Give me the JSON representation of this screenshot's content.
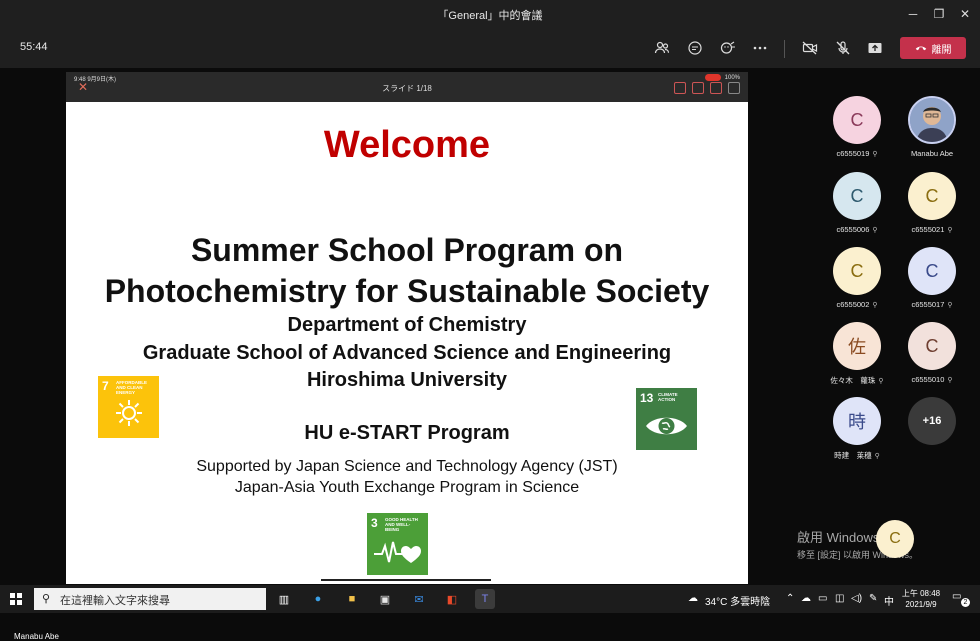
{
  "window": {
    "title": "「General」中的會議",
    "controls": {
      "minimize": "─",
      "restore": "❐",
      "close": "✕"
    }
  },
  "toolbar": {
    "timer": "55:44",
    "leave_label": "離開",
    "icons": [
      "people-icon",
      "chat-icon",
      "reactions-icon",
      "more-icon",
      "camera-off-icon",
      "mic-off-icon",
      "share-icon",
      "phone-hangup-icon"
    ]
  },
  "slide": {
    "phone_status": "9:48  9月9日(木)",
    "phone_sys": "100%",
    "slide_counter": "スライド 1/18",
    "welcome": "Welcome",
    "title_line1": "Summer School Program on",
    "title_line2": "Photochemistry for Sustainable Society",
    "dept": "Department of Chemistry",
    "school": "Graduate School of Advanced Science and Engineering",
    "univ": "Hiroshima University",
    "program": "HU e-START Program",
    "support1": "Supported by Japan Science and Technology Agency (JST)",
    "support2": "Japan-Asia Youth Exchange Program in Science",
    "sdg7": {
      "num": "7",
      "caption": "AFFORDABLE AND CLEAN ENERGY",
      "color": "#fcc30b"
    },
    "sdg13": {
      "num": "13",
      "caption": "CLIMATE ACTION",
      "color": "#3f7e44"
    },
    "sdg3": {
      "num": "3",
      "caption": "GOOD HEALTH AND WELL-BEING",
      "color": "#4c9f38"
    }
  },
  "presenter_name": "Manabu Abe",
  "participants": [
    {
      "initial": "C",
      "name": "c6555019",
      "bg": "#f6d3e0",
      "fg": "#8a3a5a"
    },
    {
      "initial": "",
      "name": "Manabu Abe",
      "bg": "#6f7fb8",
      "fg": "#ffffff"
    },
    {
      "initial": "C",
      "name": "c6555006",
      "bg": "#d6e7ef",
      "fg": "#2e5a6e"
    },
    {
      "initial": "C",
      "name": "c6555021",
      "bg": "#fbf0cf",
      "fg": "#8a6d10"
    },
    {
      "initial": "C",
      "name": "c6555002",
      "bg": "#fbf0cf",
      "fg": "#8a6d10"
    },
    {
      "initial": "C",
      "name": "c6555017",
      "bg": "#dfe4f8",
      "fg": "#3a4a8a"
    },
    {
      "initial": "佐",
      "name": "佐々木　蘿珠",
      "bg": "#f8e4d6",
      "fg": "#8a4a20"
    },
    {
      "initial": "C",
      "name": "c6555010",
      "bg": "#f2e1dc",
      "fg": "#6e3e30"
    },
    {
      "initial": "時",
      "name": "時建　莱穗",
      "bg": "#dfe4f8",
      "fg": "#3a4a8a"
    }
  ],
  "overflow_count": "+16",
  "floating_initial": "C",
  "watermark": {
    "line1": "啟用 Windows",
    "line2": "移至 [設定] 以啟用 Windows。"
  },
  "taskbar": {
    "search_placeholder": "在這裡輸入文字來搜尋",
    "weather": "34°C  多雲時陰",
    "ime": "中",
    "time": "上午 08:48",
    "date": "2021/9/9",
    "notifications": "2"
  }
}
